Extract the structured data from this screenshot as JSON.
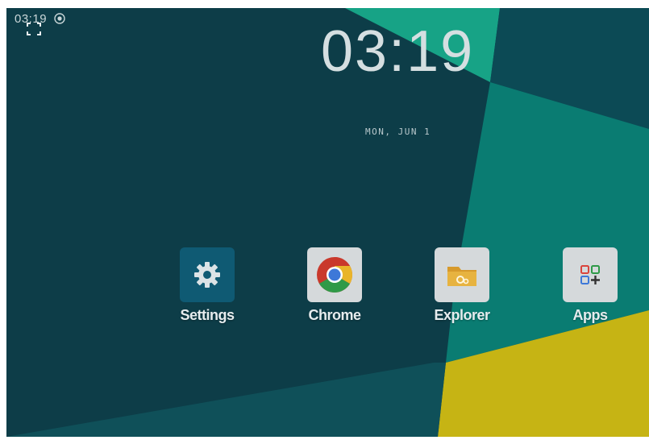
{
  "status_bar": {
    "time": "03:19",
    "icons": [
      "fullscreen-icon",
      "location-icon"
    ]
  },
  "clock": {
    "time": "03:19",
    "date": "MON, JUN 1"
  },
  "apps": [
    {
      "label": "Settings",
      "icon": "gear-icon",
      "color": "#0f5a73"
    },
    {
      "label": "Chrome",
      "icon": "chrome-icon",
      "color": "#d5d9db"
    },
    {
      "label": "Explorer",
      "icon": "folder-icon",
      "color": "#d5d9db"
    },
    {
      "label": "Apps",
      "icon": "app-grid-icon",
      "color": "#d5d9db"
    }
  ],
  "colors": {
    "wallpaper_dark": "#0d3d48",
    "wallpaper_teal": "#0a7c72",
    "wallpaper_green": "#17a386",
    "wallpaper_yellow": "#c6b414"
  }
}
